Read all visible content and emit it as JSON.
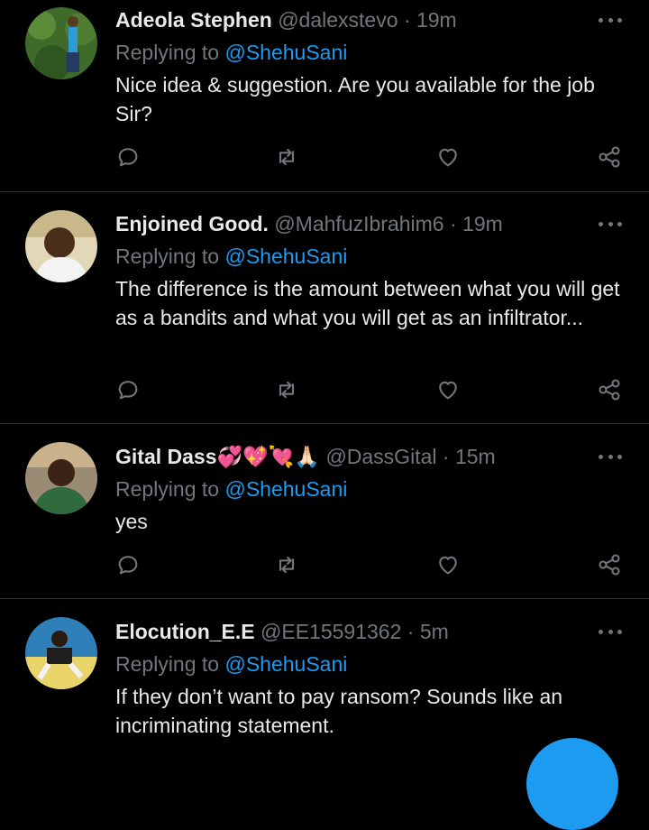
{
  "tweets": [
    {
      "name": "Adeola Stephen",
      "handle": "@dalexstevo",
      "dot": "·",
      "time": "19m",
      "replying_prefix": "Replying to",
      "replying_to": "@ShehuSani",
      "text": "Nice idea & suggestion. Are you available for the job Sir?"
    },
    {
      "name": "Enjoined Good.",
      "handle": "@MahfuzIbrahim6",
      "dot": "·",
      "time": "19m",
      "replying_prefix": "Replying to",
      "replying_to": "@ShehuSani",
      "text": "The difference is the amount between what you will get as a bandits and what you will get as an infiltrator..."
    },
    {
      "name": "Gital Dass💞💖💘🙏🏻",
      "handle": "@DassGital",
      "dot": "·",
      "time": "15m",
      "replying_prefix": "Replying to",
      "replying_to": "@ShehuSani",
      "text": "yes"
    },
    {
      "name": "Elocution_E.E",
      "handle": "@EE15591362",
      "dot": "·",
      "time": "5m",
      "replying_prefix": "Replying to",
      "replying_to": "@ShehuSani",
      "text": "If they don’t want to pay ransom? Sounds like an incriminating statement."
    }
  ],
  "icons": {
    "reply": "reply-icon",
    "retweet": "retweet-icon",
    "like": "heart-icon",
    "share": "share-icon",
    "more": "more-icon",
    "compose": "compose-fab"
  },
  "colors": {
    "background": "#000000",
    "text": "#e7e9ea",
    "muted": "#71767b",
    "accent": "#1d9bf0",
    "divider": "#2f3336"
  }
}
